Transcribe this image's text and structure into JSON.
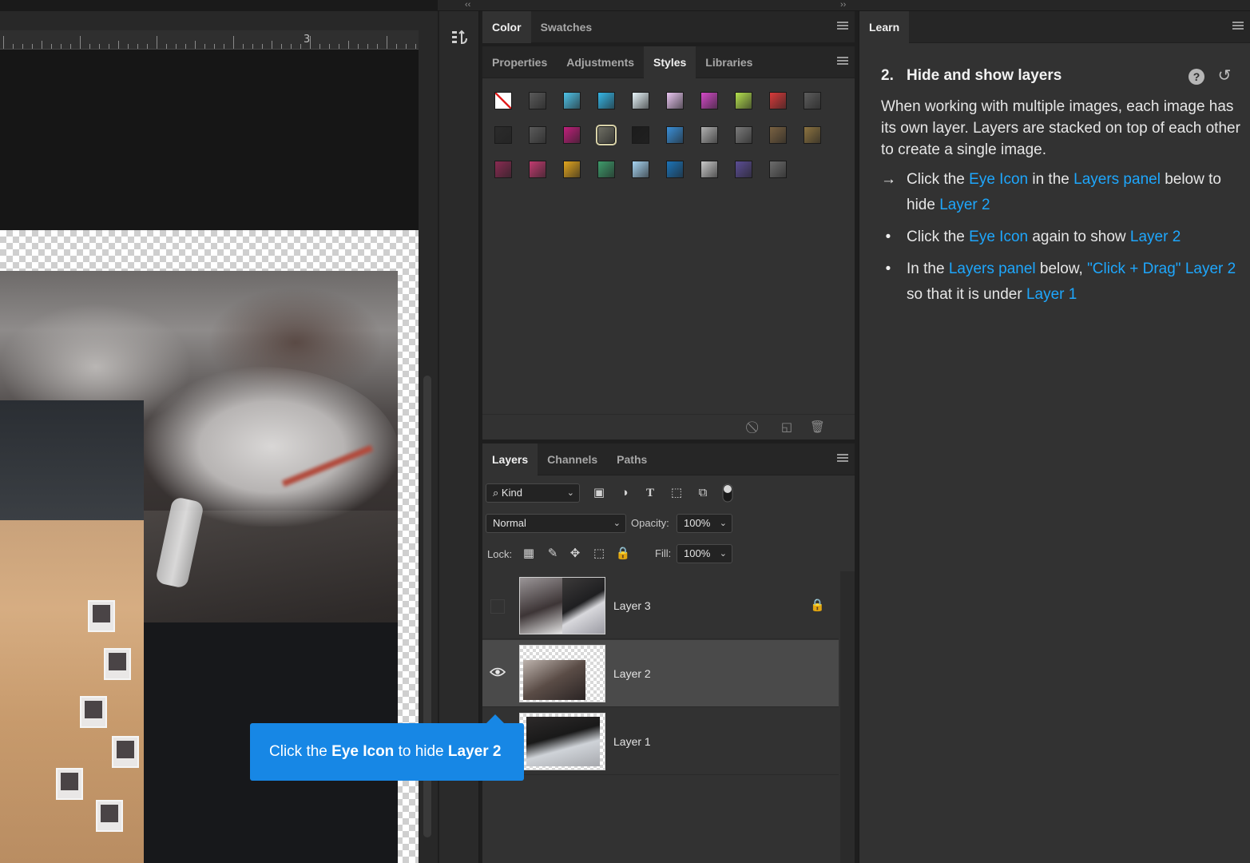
{
  "ruler": {
    "number": "3"
  },
  "dock": {
    "collapse_left": "‹‹",
    "collapse_right": "››"
  },
  "color_panel": {
    "tabs": [
      "Color",
      "Swatches"
    ]
  },
  "styles_panel": {
    "tabs": [
      "Properties",
      "Adjustments",
      "Styles",
      "Libraries"
    ],
    "active_tab": "Styles",
    "swatches": [
      [
        "#ffffff",
        "#5a5a5a",
        "#4fc3e8",
        "#35b6e6",
        "#e8f6fb",
        "#e8c5f0",
        "#d44ac9",
        "#b4e04e",
        "#d93a3a",
        "#5c5c5c"
      ],
      [
        "#2b2b2b",
        "#5b5b5b",
        "#c01f7b",
        "#6f6f64",
        "#1c1c1c",
        "#3a90d8",
        "#b0b0b0",
        "#7a7a7a",
        "#7a6242",
        "#8c7340"
      ],
      [
        "#8a2b52",
        "#c23b70",
        "#e2a61e",
        "#3e9c6b",
        "#a7d4f2",
        "#1b73b8",
        "#c9c9c9",
        "#5b4d94",
        "#6d6d6d"
      ]
    ]
  },
  "layers_panel": {
    "tabs": [
      "Layers",
      "Channels",
      "Paths"
    ],
    "filter": {
      "kind_label": "Kind"
    },
    "blend_mode": "Normal",
    "opacity_label": "Opacity:",
    "opacity_value": "100%",
    "lock_label": "Lock:",
    "fill_label": "Fill:",
    "fill_value": "100%",
    "layers": [
      {
        "name": "Layer 3",
        "visible": false,
        "locked": true
      },
      {
        "name": "Layer 2",
        "visible": true,
        "locked": false,
        "selected": true
      },
      {
        "name": "Layer 1",
        "visible": false,
        "locked": false
      }
    ]
  },
  "learn_panel": {
    "tab": "Learn",
    "step_number": "2.",
    "title": "Hide and show layers",
    "description": "When working with multiple images, each image has its own layer. Layers are stacked on top of each other to create a single image.",
    "steps": [
      {
        "marker": "→",
        "parts": [
          {
            "t": "Click the "
          },
          {
            "t": "Eye Icon",
            "hl": true
          },
          {
            "t": " in the "
          },
          {
            "t": "Layers panel",
            "hl": true
          },
          {
            "t": " below to hide "
          },
          {
            "t": "Layer 2",
            "hl": true
          }
        ]
      },
      {
        "marker": "•",
        "parts": [
          {
            "t": "Click the "
          },
          {
            "t": "Eye Icon",
            "hl": true
          },
          {
            "t": " again to show "
          },
          {
            "t": "Layer 2",
            "hl": true
          }
        ]
      },
      {
        "marker": "•",
        "parts": [
          {
            "t": "In the "
          },
          {
            "t": "Layers panel",
            "hl": true
          },
          {
            "t": " below, "
          },
          {
            "t": "\"Click + Drag\"",
            "hl": true
          },
          {
            "t": " "
          },
          {
            "t": "Layer 2",
            "hl": true
          },
          {
            "t": " so that it is under "
          },
          {
            "t": "Layer 1",
            "hl": true
          }
        ]
      }
    ]
  },
  "tooltip": {
    "parts": [
      {
        "t": "Click the "
      },
      {
        "t": "Eye Icon",
        "b": true
      },
      {
        "t": " to hide "
      },
      {
        "t": "Layer 2",
        "b": true
      }
    ]
  },
  "colors": {
    "accent": "#1ea7fd",
    "tooltip_bg": "#1787e5",
    "panel_bg": "#323232"
  }
}
